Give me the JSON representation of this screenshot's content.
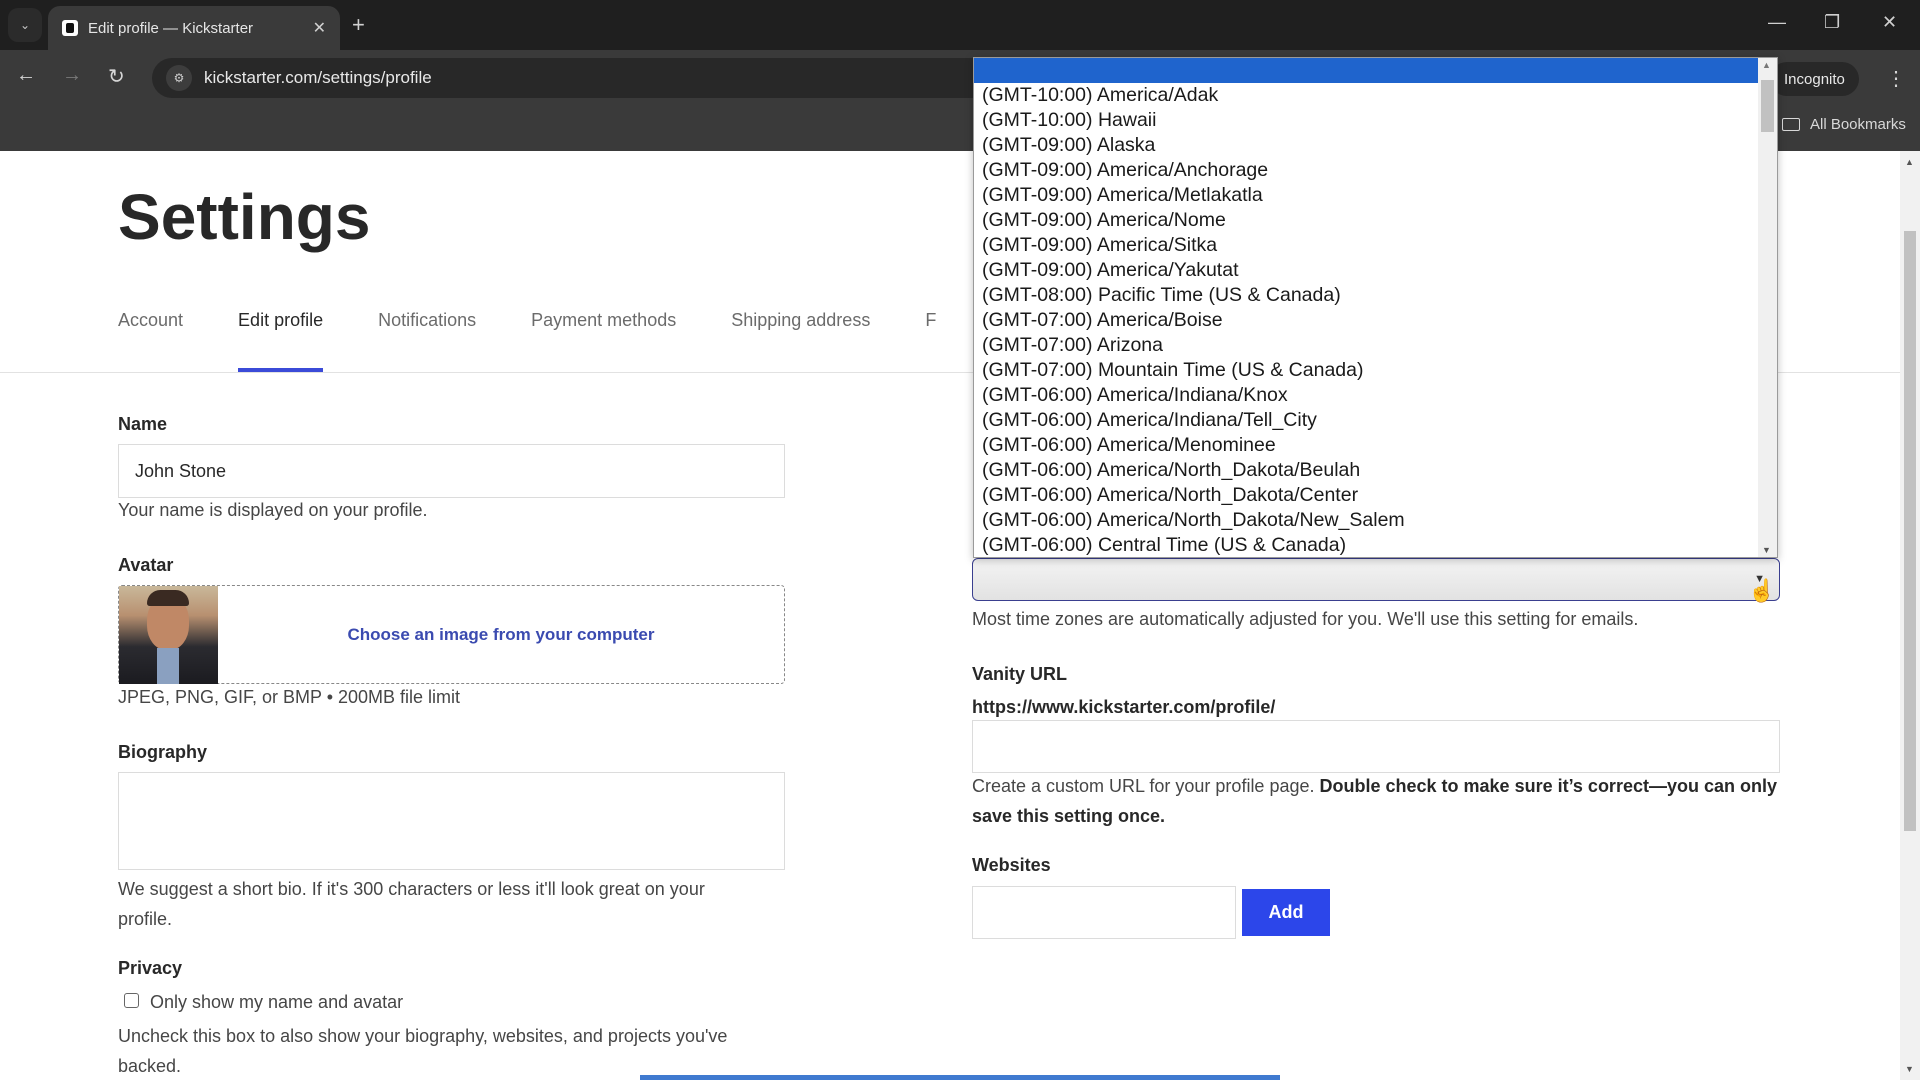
{
  "browser": {
    "tab_title": "Edit profile — Kickstarter",
    "url": "kickstarter.com/settings/profile",
    "incognito_label": "Incognito",
    "bookmarks_label": "All Bookmarks"
  },
  "page": {
    "title": "Settings",
    "tabs": [
      {
        "label": "Account",
        "active": false
      },
      {
        "label": "Edit profile",
        "active": true
      },
      {
        "label": "Notifications",
        "active": false
      },
      {
        "label": "Payment methods",
        "active": false
      },
      {
        "label": "Shipping address",
        "active": false
      },
      {
        "label": "F",
        "active": false
      }
    ],
    "name": {
      "label": "Name",
      "value": "John Stone",
      "help": "Your name is displayed on your profile."
    },
    "avatar": {
      "label": "Avatar",
      "choose_link": "Choose an image from your computer",
      "help": "JPEG, PNG, GIF, or BMP • 200MB file limit"
    },
    "biography": {
      "label": "Biography",
      "value": "",
      "help": "We suggest a short bio. If it's 300 characters or less it'll look great on your profile."
    },
    "privacy": {
      "label": "Privacy",
      "checkbox_label": "Only show my name and avatar",
      "checked": false,
      "help": "Uncheck this box to also show your biography, websites, and projects you've backed."
    },
    "timezone": {
      "selected_value": "",
      "help": "Most time zones are automatically adjusted for you. We'll use this setting for emails.",
      "options": [
        "(GMT-10:00) America/Adak",
        "(GMT-10:00) Hawaii",
        "(GMT-09:00) Alaska",
        "(GMT-09:00) America/Anchorage",
        "(GMT-09:00) America/Metlakatla",
        "(GMT-09:00) America/Nome",
        "(GMT-09:00) America/Sitka",
        "(GMT-09:00) America/Yakutat",
        "(GMT-08:00) Pacific Time (US & Canada)",
        "(GMT-07:00) America/Boise",
        "(GMT-07:00) Arizona",
        "(GMT-07:00) Mountain Time (US & Canada)",
        "(GMT-06:00) America/Indiana/Knox",
        "(GMT-06:00) America/Indiana/Tell_City",
        "(GMT-06:00) America/Menominee",
        "(GMT-06:00) America/North_Dakota/Beulah",
        "(GMT-06:00) America/North_Dakota/Center",
        "(GMT-06:00) America/North_Dakota/New_Salem",
        "(GMT-06:00) Central Time (US & Canada)"
      ]
    },
    "vanity_url": {
      "label": "Vanity URL",
      "prefix": "https://www.kickstarter.com/profile/",
      "value": "",
      "help_regular": "Create a custom URL for your profile page. ",
      "help_bold": "Double check to make sure it’s correct—you can only save this setting once."
    },
    "websites": {
      "label": "Websites",
      "value": "",
      "add_label": "Add"
    }
  },
  "colors": {
    "accent": "#2c46ea",
    "tab_underline": "#3b4bd8",
    "dropdown_highlight": "#1f64cd"
  }
}
